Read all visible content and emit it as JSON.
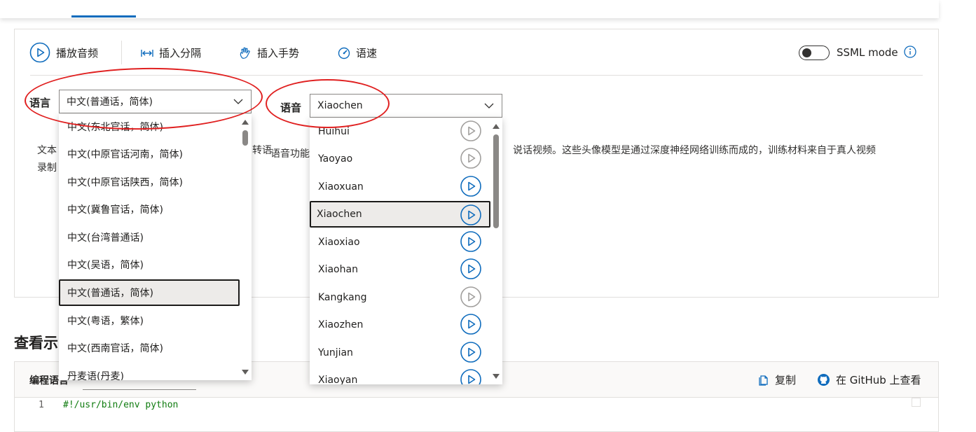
{
  "toolbar": {
    "play_label": "播放音频",
    "insert_break_label": "插入分隔",
    "insert_gesture_label": "插入手势",
    "speed_label": "语速",
    "ssml_label": "SSML mode"
  },
  "language": {
    "label": "语言",
    "selected": "中文(普通话，简体)",
    "options": [
      "中文(东北官话，简体)",
      "中文(中原官话河南，简体)",
      "中文(中原官话陕西，简体)",
      "中文(冀鲁官话，简体)",
      "中文(台湾普通话)",
      "中文(吴语，简体)",
      "中文(普通话，简体)",
      "中文(粤语，繁体)",
      "中文(西南官话，简体)",
      "丹麦语(丹麦)"
    ]
  },
  "voice": {
    "label": "语音",
    "selected": "Xiaochen",
    "options": [
      {
        "name": "Huihui",
        "enabled": false
      },
      {
        "name": "Yaoyao",
        "enabled": false
      },
      {
        "name": "Xiaoxuan",
        "enabled": true
      },
      {
        "name": "Xiaochen",
        "enabled": true
      },
      {
        "name": "Xiaoxiao",
        "enabled": true
      },
      {
        "name": "Xiaohan",
        "enabled": true
      },
      {
        "name": "Kangkang",
        "enabled": false
      },
      {
        "name": "Xiaozhen",
        "enabled": true
      },
      {
        "name": "Yunjian",
        "enabled": true
      },
      {
        "name": "Xiaoyan",
        "enabled": true
      }
    ]
  },
  "description": {
    "line1_start": "文本",
    "line1_mid_a": "转语",
    "line1_mid_b": "语音功能",
    "line1_end": "说话视频。这些头像模型是通过深度神经网络训练而成的，训练材料来自于真人视频",
    "line2_start": "录制"
  },
  "samples": {
    "title": "查看示",
    "code_language_label": "编程语言",
    "copy_label": "复制",
    "github_label": "在 GitHub 上查看",
    "line_number": "1",
    "code_line": "#!/usr/bin/env python"
  },
  "colors": {
    "accent": "#0f6cbd",
    "annotation": "#e02020",
    "disabled_icon": "#a19f9d"
  }
}
